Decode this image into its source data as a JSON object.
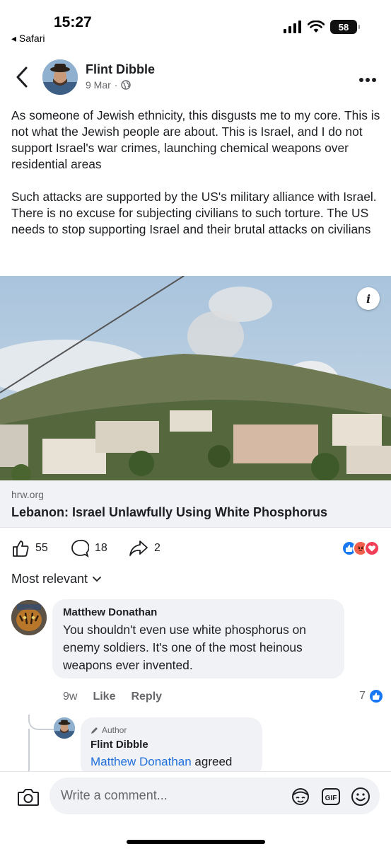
{
  "status_bar": {
    "time": "15:27",
    "back_app": "◂ Safari",
    "battery": "58"
  },
  "post": {
    "author": "Flint Dibble",
    "date": "9 Mar",
    "date_separator": "·",
    "paragraphs": [
      "As someone of Jewish ethnicity, this disgusts me to my core. This is not what the Jewish people are about. This is Israel, and I do not support Israel's war crimes, launching chemical weapons over residential areas",
      "Such attacks are supported by the US's military alliance with Israel. There is no excuse for subjecting civilians to such torture. The US needs to stop supporting Israel and their brutal attacks on civilians"
    ],
    "link": {
      "domain": "hrw.org",
      "title": "Lebanon: Israel Unlawfully Using White Phosphorus"
    },
    "likes": "55",
    "comments": "18",
    "shares": "2",
    "reaction_icons": [
      "like-icon",
      "angry-icon",
      "love-icon"
    ]
  },
  "comments_section": {
    "sort_label": "Most relevant",
    "comment": {
      "author": "Matthew Donathan",
      "text": "You shouldn't even use white phosphorus on enemy soldiers.  It's one of the most heinous weapons ever invented.",
      "age": "9w",
      "like_label": "Like",
      "reply_label": "Reply",
      "like_count": "7"
    },
    "reply": {
      "badge": "Author",
      "author": "Flint Dibble",
      "mention": "Matthew Donathan",
      "text": " agreed"
    }
  },
  "composer": {
    "placeholder": "Write a comment..."
  },
  "colors": {
    "accent_blue": "#216fdb",
    "bubble_bg": "#f0f2f5",
    "secondary_text": "#65676b"
  }
}
